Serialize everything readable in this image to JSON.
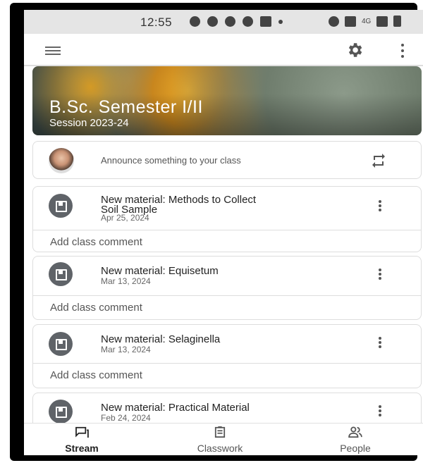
{
  "status_bar": {
    "time": "12:55",
    "network": "4G"
  },
  "header": {},
  "banner": {
    "title": "B.Sc. Semester I/II",
    "subtitle": "Session 2023-24"
  },
  "announce": {
    "placeholder": "Announce something to your class"
  },
  "posts": [
    {
      "title_line1": "New material: Methods to Collect",
      "title_line2": "Soil Sample",
      "date": "Apr 25, 2024",
      "comment": "Add class comment"
    },
    {
      "title_line1": "New material: Equisetum",
      "date": "Mar 13, 2024",
      "comment": "Add class comment"
    },
    {
      "title_line1": "New material: Selaginella",
      "date": "Mar 13, 2024",
      "comment": "Add class comment"
    },
    {
      "title_line1": "New material: Practical Material",
      "date": "Feb 24, 2024"
    }
  ],
  "bottom_nav": [
    {
      "label": "Stream",
      "icon": "stream-icon",
      "active": true
    },
    {
      "label": "Classwork",
      "icon": "classwork-icon",
      "active": false
    },
    {
      "label": "People",
      "icon": "people-icon",
      "active": false
    }
  ]
}
